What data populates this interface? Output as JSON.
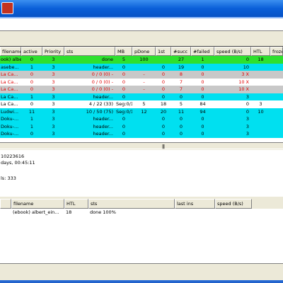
{
  "colors": {
    "done": "#2ee02e",
    "active": "#00e0f0",
    "inactive": "#ffffff",
    "failed": "#c8c8c8",
    "failed_text": "#e00000",
    "titlebar": "#0a5fd8"
  },
  "grid": {
    "columns": [
      "filename",
      "active",
      "Priority",
      "sts",
      "MB",
      "pDone",
      "1st",
      "#succ",
      "#failed",
      "speed (B/s)",
      "HTL",
      "frozen"
    ],
    "rows": [
      {
        "status": "done",
        "cells": [
          "ook) albert_ei...",
          "0",
          "3",
          "done",
          "5",
          "100",
          "",
          "27",
          "1",
          "0",
          "18",
          ""
        ]
      },
      {
        "status": "active",
        "cells": [
          "asebe...",
          "1",
          "3",
          "header...",
          "0",
          "",
          "0",
          "19",
          "0",
          "10",
          "",
          ""
        ]
      },
      {
        "status": "failed",
        "cells": [
          "La Ca...",
          "0",
          "3",
          "0 / 0 (0) -",
          "0",
          "-",
          "0",
          "8",
          "0",
          "3 X",
          "",
          ""
        ]
      },
      {
        "status": "inactive",
        "cells": [
          "La Ca...",
          "0",
          "3",
          "0 / 0 (0) -",
          "0",
          "-",
          "0",
          "7",
          "0",
          "10 X",
          "",
          ""
        ]
      },
      {
        "status": "failed",
        "cells": [
          "La Ca...",
          "0",
          "3",
          "0 / 0 (0) -",
          "0",
          "-",
          "0",
          "7",
          "0",
          "10 X",
          "",
          ""
        ]
      },
      {
        "status": "active",
        "cells": [
          "La Ca...",
          "1",
          "3",
          "header...",
          "0",
          "",
          "0",
          "0",
          "0",
          "3",
          "",
          ""
        ]
      },
      {
        "status": "inactive",
        "cells": [
          "La Ca...",
          "0",
          "3",
          "4 / 22 (33)",
          "Seg:0/1",
          "5",
          "18",
          "5",
          "84",
          "0",
          "3",
          ""
        ]
      },
      {
        "status": "active",
        "cells": [
          "Ludwi...",
          "11",
          "3",
          "10 / 50 (75)",
          "Seg:0/1",
          "12",
          "20",
          "11",
          "94",
          "0",
          "10",
          ""
        ]
      },
      {
        "status": "active",
        "cells": [
          "Doku-...",
          "1",
          "3",
          "header...",
          "0",
          "",
          "0",
          "0",
          "0",
          "3",
          "",
          ""
        ]
      },
      {
        "status": "active",
        "cells": [
          "Doku-...",
          "1",
          "3",
          "header...",
          "0",
          "",
          "0",
          "0",
          "0",
          "3",
          "",
          ""
        ]
      },
      {
        "status": "active",
        "cells": [
          "Doku-...",
          "0",
          "3",
          "header...",
          "0",
          "",
          "0",
          "0",
          "0",
          "3",
          "",
          ""
        ]
      }
    ]
  },
  "info": {
    "line1": "10223616",
    "line2": "days, 00:45:11",
    "line3": "ls: 333"
  },
  "lower": {
    "columns": [
      "",
      "filename",
      "HTL",
      "sts",
      "last ins",
      "speed (B/s)"
    ],
    "row": [
      "",
      "(ebook) albert_ein...",
      "18",
      "done 100%",
      "",
      ""
    ]
  }
}
